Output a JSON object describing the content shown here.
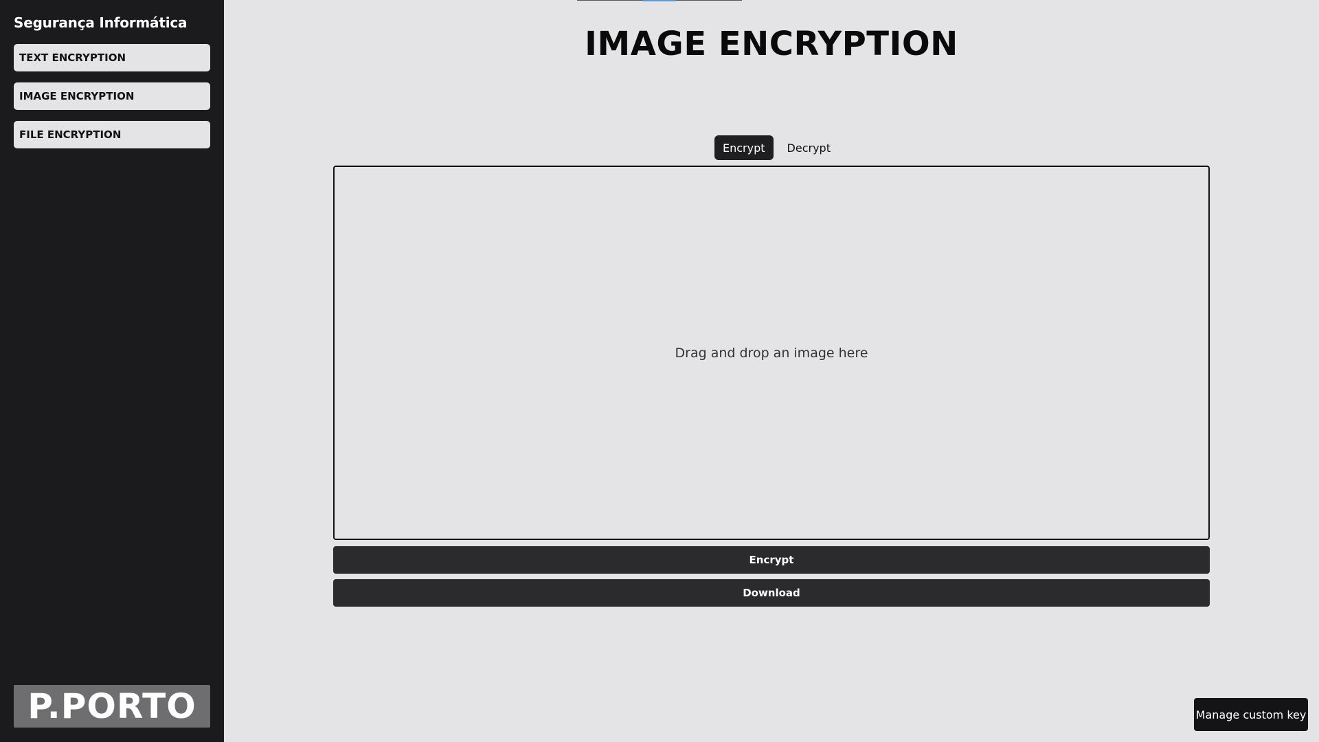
{
  "sidebar": {
    "title": "Segurança Informática",
    "items": [
      {
        "label": "TEXT ENCRYPTION"
      },
      {
        "label": "IMAGE ENCRYPTION"
      },
      {
        "label": "FILE ENCRYPTION"
      }
    ],
    "logo_text": "P.PORTO"
  },
  "main": {
    "title": "IMAGE ENCRYPTION",
    "tabs": [
      {
        "label": "Encrypt",
        "active": true
      },
      {
        "label": "Decrypt",
        "active": false
      }
    ],
    "dropzone_text": "Drag and drop an image here",
    "encrypt_button": "Encrypt",
    "download_button": "Download"
  },
  "manage_key_button": "Manage custom key",
  "colors": {
    "sidebar_bg": "#1b1b1e",
    "page_bg": "#e4e4e7",
    "button_bg": "#2b2b2e",
    "accent": "#5b9bd5"
  }
}
